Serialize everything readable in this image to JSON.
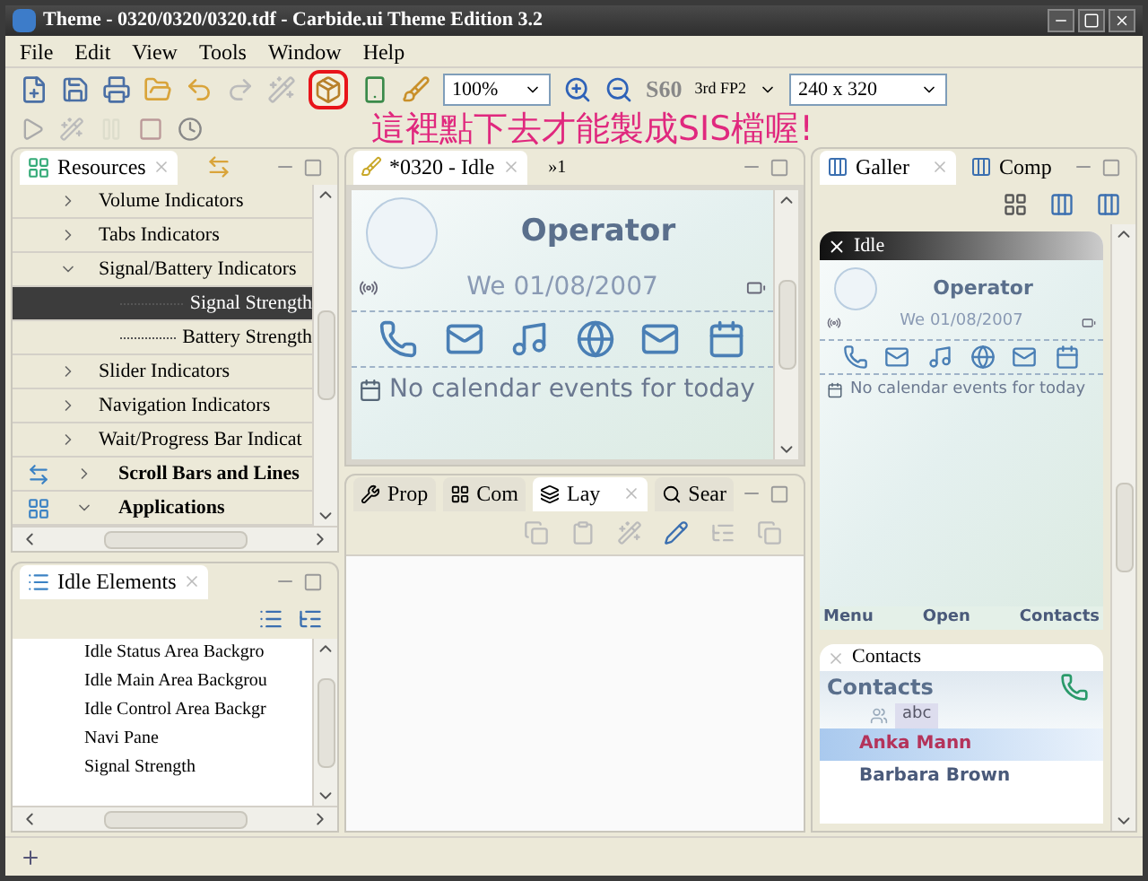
{
  "window": {
    "title": "Theme - 0320/0320/0320.tdf - Carbide.ui Theme Edition 3.2"
  },
  "menu": [
    "File",
    "Edit",
    "View",
    "Tools",
    "Window",
    "Help"
  ],
  "toolbar": {
    "zoom": "100%",
    "platform": "S60",
    "platform_version": "3rd FP2",
    "resolution": "240 x 320"
  },
  "annotation": "這裡點下去才能製成SIS檔喔!",
  "resources": {
    "tab": "Resources",
    "items": [
      {
        "label": "Volume Indicators",
        "expanded": false,
        "selected": false
      },
      {
        "label": "Tabs Indicators",
        "expanded": false,
        "selected": false
      },
      {
        "label": "Signal/Battery Indicators",
        "expanded": true,
        "selected": false,
        "children": [
          {
            "label": "Signal Strength",
            "selected": true
          },
          {
            "label": "Battery Strength",
            "selected": false
          }
        ]
      },
      {
        "label": "Slider Indicators",
        "expanded": false,
        "selected": false
      },
      {
        "label": "Navigation Indicators",
        "expanded": false,
        "selected": false
      },
      {
        "label": "Wait/Progress Bar Indicat",
        "expanded": false,
        "selected": false
      }
    ],
    "categories": [
      {
        "label": "Scroll Bars and Lines",
        "expanded": false
      },
      {
        "label": "Applications",
        "expanded": true
      }
    ]
  },
  "editor": {
    "tabs": [
      {
        "label": "*0320 - Idle",
        "selected": true
      }
    ],
    "overflow": "»1",
    "preview": {
      "operator": "Operator",
      "date": "We 01/08/2007",
      "calendar": "No calendar events for today"
    }
  },
  "bottom_panel": {
    "tabs": [
      {
        "label": "Prop",
        "selected": false
      },
      {
        "label": "Com",
        "selected": false
      },
      {
        "label": "Lay",
        "selected": true
      },
      {
        "label": "Sear",
        "selected": false
      }
    ]
  },
  "idle_elements": {
    "tab": "Idle Elements",
    "items": [
      "Idle Status Area Backgro",
      "Idle Main Area Backgrou",
      "Idle Control Area Backgr",
      "Navi Pane",
      "Signal Strength"
    ]
  },
  "gallery": {
    "tabs": [
      {
        "label": "Galler",
        "selected": true
      },
      {
        "label": "Comp",
        "selected": false
      }
    ],
    "cards": [
      {
        "kind": "idle",
        "title": "Idle",
        "operator": "Operator",
        "date": "We 01/08/2007",
        "calendar": "No calendar events for today",
        "softkeys": [
          "Menu",
          "Open",
          "Contacts"
        ]
      },
      {
        "kind": "contacts",
        "title": "Contacts",
        "heading": "Contacts",
        "tab_label": "abc",
        "rows": [
          {
            "name": "Anka Mann",
            "selected": true
          },
          {
            "name": "Barbara Brown",
            "selected": false
          }
        ]
      }
    ]
  }
}
